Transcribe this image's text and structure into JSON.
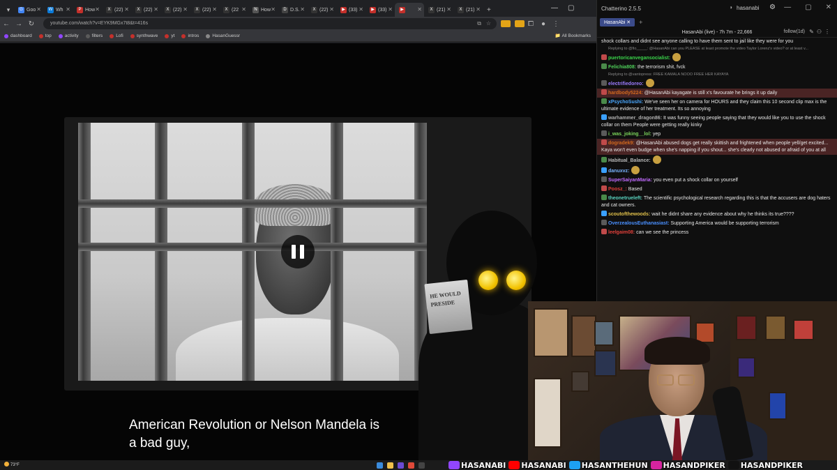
{
  "browser": {
    "tabs": [
      {
        "label": "Goo",
        "color": "#4285f4",
        "glyph": "G"
      },
      {
        "label": "Wh",
        "color": "#0c7bd9",
        "glyph": "W"
      },
      {
        "label": "How",
        "color": "#c4302b",
        "glyph": "P"
      },
      {
        "label": "(22)",
        "color": "#333333",
        "glyph": "X"
      },
      {
        "label": "(22)",
        "color": "#333333",
        "glyph": "X"
      },
      {
        "label": "(22)",
        "color": "#333333",
        "glyph": "X"
      },
      {
        "label": "(22)",
        "color": "#333333",
        "glyph": "X"
      },
      {
        "label": "(22",
        "color": "#333333",
        "glyph": "X"
      },
      {
        "label": "How",
        "color": "#555555",
        "glyph": "N"
      },
      {
        "label": "D.S.",
        "color": "#444444",
        "glyph": "D"
      },
      {
        "label": "(22)",
        "color": "#333333",
        "glyph": "X"
      },
      {
        "label": "(33)",
        "color": "#c4302b",
        "glyph": "▶"
      },
      {
        "label": "(33)",
        "color": "#c4302b",
        "glyph": "▶"
      },
      {
        "label": "",
        "color": "#c4302b",
        "glyph": "▶"
      },
      {
        "label": "(21)",
        "color": "#333333",
        "glyph": "X"
      },
      {
        "label": "(21)",
        "color": "#333333",
        "glyph": "X"
      }
    ],
    "url": "youtube.com/watch?v=EYK9MGx7t8&t=416s",
    "bookmarks": [
      {
        "label": "dashboard",
        "color": "#9146ff"
      },
      {
        "label": "top",
        "color": "#c4302b"
      },
      {
        "label": "activity",
        "color": "#9146ff"
      },
      {
        "label": "filters",
        "color": "#5a5a5a"
      },
      {
        "label": "Lofi",
        "color": "#c4302b"
      },
      {
        "label": "synthwave",
        "color": "#c4302b"
      },
      {
        "label": "yt",
        "color": "#c4302b"
      },
      {
        "label": "intros",
        "color": "#c4302b"
      },
      {
        "label": "HasanGuessr",
        "color": "#888888"
      }
    ],
    "all_bookmarks": "All Bookmarks"
  },
  "video": {
    "caption_line1": "American Revolution or Nelson Mandela is",
    "caption_line2": "a bad guy,",
    "newspaper_line1": "HE WOULD",
    "newspaper_line2": "PRESIDE"
  },
  "chat": {
    "app_title": "Chatterino 2.5.5",
    "user": "hasanabi",
    "tab_label": "HasanAbi",
    "header": "HasanAbi (live) - 7h 7m - 22,666",
    "follow": "follow(1d)",
    "messages": [
      {
        "kind": "plain",
        "name": "",
        "color": "#e8e8e8",
        "text": "shock collars and didnt see anyone calling to have them sent to jail like they were for you"
      },
      {
        "kind": "reply",
        "name": "",
        "color": "#888",
        "text": "Replying to @fio_____: @HasanAbi can you PLEASE at least promote the video Taylor Lorenz's video? or at least v..."
      },
      {
        "kind": "plain",
        "name": "puertoricanvegansocialist:",
        "color": "#3ad44a",
        "text": ""
      },
      {
        "kind": "plain",
        "name": "Felichia808:",
        "color": "#4fd05a",
        "text": "the terrorism shit, fvck"
      },
      {
        "kind": "reply",
        "name": "",
        "color": "#888",
        "text": "Replying to @vantopress: FREE KAMALA NOOO FREE HER KAYAYA"
      },
      {
        "kind": "plain",
        "name": "electrifiedoreo:",
        "color": "#9b7cff",
        "text": ""
      },
      {
        "kind": "hl",
        "name": "hardbody5224:",
        "color": "#d2691e",
        "text": "@HasanAbi kayagate is still x's favourate he brings it up daily"
      },
      {
        "kind": "plain",
        "name": "xPsychoSushi:",
        "color": "#4aa8ff",
        "text": "We've seen her on camera for HOURS and they claim this 10 second clip max is the ultimate evidence of her treatment. Its so annoying"
      },
      {
        "kind": "plain",
        "name": "warhammer_dragon86:",
        "color": "#b0b0b0",
        "text": "It was funny seeing people saying that they would like you to use the shock collar on them      People were getting really kinky"
      },
      {
        "kind": "plain",
        "name": "i_was_joking__lol:",
        "color": "#7ad45a",
        "text": "yep"
      },
      {
        "kind": "hl",
        "name": "dogradek9:",
        "color": "#d2691e",
        "text": "@HasanAbi abused dogs get really skittish and frightened when people yell/get excited... Kaya won't even budge when she's napping if you shout... she's clearly not abused or afraid of you at all"
      },
      {
        "kind": "plain",
        "name": "Habitual_Balance:",
        "color": "#b9b9b9",
        "text": ""
      },
      {
        "kind": "plain",
        "name": "danuxvz:",
        "color": "#7ab4ff",
        "text": ""
      },
      {
        "kind": "plain",
        "name": "SuperSaiyanMaria:",
        "color": "#c16bff",
        "text": "you even put a shock collar on yourself"
      },
      {
        "kind": "plain",
        "name": "Poosz_:",
        "color": "#e0403a",
        "text": "Based"
      },
      {
        "kind": "plain",
        "name": "theonetrueleft:",
        "color": "#5ad4c0",
        "text": "The scientific psychological research regarding this is that the accusers are dog haters and cat owners."
      },
      {
        "kind": "plain",
        "name": "scoutofthewoods:",
        "color": "#e0c04a",
        "text": "wait he didnt share any evidence about why he thinks its true????"
      },
      {
        "kind": "plain",
        "name": "OverzealousEuthanasiast:",
        "color": "#4a90ff",
        "text": "Supporting America would be supporting terrorism"
      },
      {
        "kind": "plain",
        "name": "leelgaim08:",
        "color": "#e0403a",
        "text": "can we see the princess"
      }
    ]
  },
  "taskbar": {
    "weather": "73°F",
    "socials": [
      {
        "label": "HASANABI",
        "color": "#9146ff",
        "icon": "twitch-icon"
      },
      {
        "label": "HASANABI",
        "color": "#ff0000",
        "icon": "youtube-icon"
      },
      {
        "label": "HASANTHEHUN",
        "color": "#1da1f2",
        "icon": "twitter-icon"
      },
      {
        "label": "HASANDPIKER",
        "color": "#d6249f",
        "icon": "instagram-icon"
      },
      {
        "label": "HASANDPIKER",
        "color": "#111111",
        "icon": "tiktok-icon"
      }
    ]
  }
}
